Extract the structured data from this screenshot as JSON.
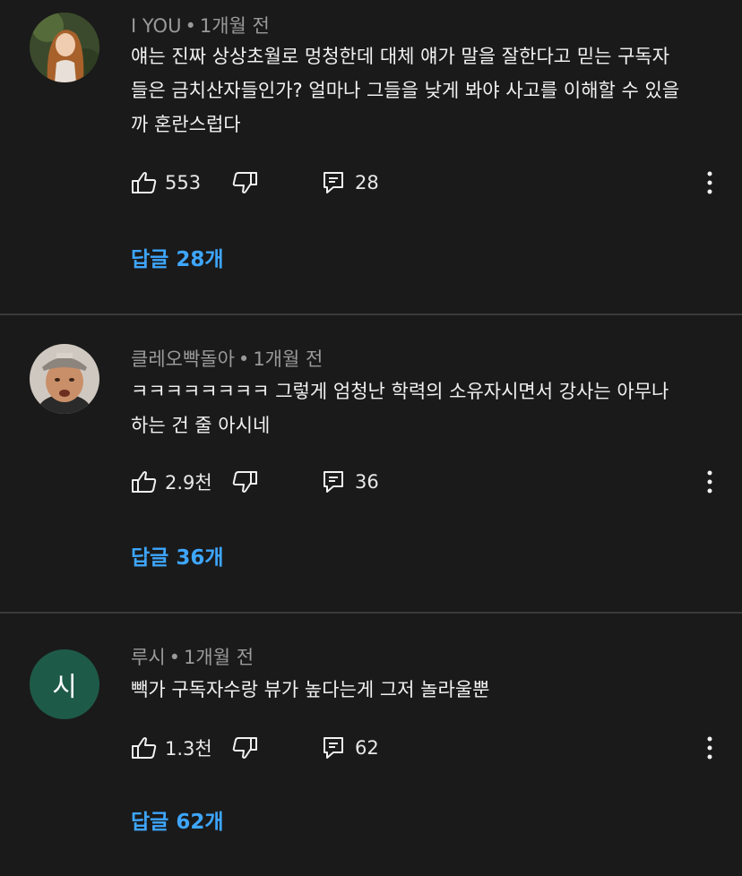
{
  "comments": [
    {
      "author": "I YOU",
      "time": "1개월 전",
      "text_lines": [
        "얘는 진짜 상상초월로 멍청한데 대체 얘가 말을 잘한다고 믿는 구독자",
        "들은 금치산자들인가? 얼마나 그들을 낮게 봐야 사고를 이해할 수 있을",
        "까 혼란스럽다"
      ],
      "likes": "553",
      "reply_count": "28",
      "replies_label": "답글 28개",
      "avatar": "portrait-girl"
    },
    {
      "author": "클레오빡돌아",
      "time": "1개월 전",
      "text_lines": [
        "ㅋㅋㅋㅋㅋㅋㅋㅋ 그렇게 엄청난 학력의 소유자시면서 강사는 아무나",
        "하는 건 줄 아시네"
      ],
      "likes": "2.9천",
      "reply_count": "36",
      "replies_label": "답글 36개",
      "avatar": "man-cap"
    },
    {
      "author": "루시",
      "time": "1개월 전",
      "text_lines": [
        "빽가 구독자수랑 뷰가 높다는게 그저 놀라울뿐"
      ],
      "likes": "1.3천",
      "reply_count": "62",
      "replies_label": "답글 62개",
      "avatar_letter": "시",
      "avatar_color": "#1e5a48"
    }
  ],
  "separator": "•",
  "colors": {
    "background": "#1a1a1a",
    "link": "#3ea6ff",
    "meta": "#9a9a9a"
  },
  "icons": [
    "thumb-up-icon",
    "thumb-down-icon",
    "reply-icon",
    "more-vert-icon"
  ]
}
